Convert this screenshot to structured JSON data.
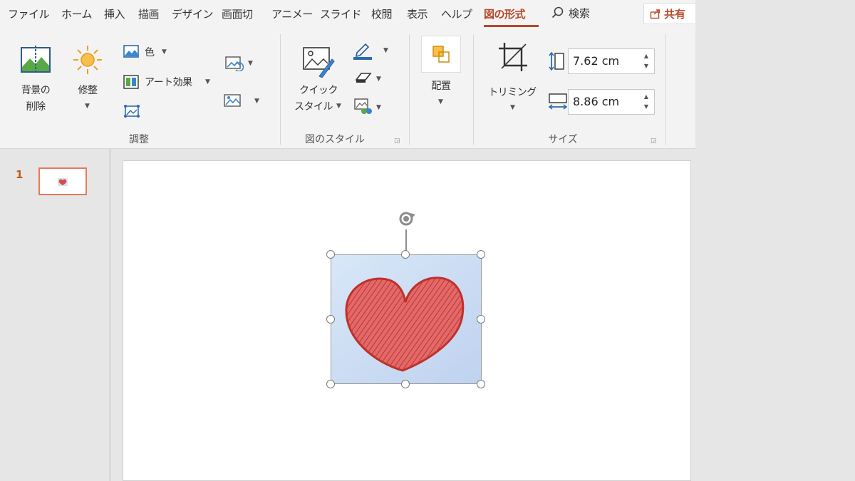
{
  "tabs": [
    "ファイル",
    "ホーム",
    "挿入",
    "描画",
    "デザイン",
    "画面切",
    "アニメー",
    "スライド",
    "校閲",
    "表示",
    "ヘルプ",
    "図の形式"
  ],
  "active_tab": "図の形式",
  "search_label": "検索",
  "share_label": "共有",
  "ribbon": {
    "remove_bg_line1": "背景の",
    "remove_bg_line2": "削除",
    "corrections": "修整",
    "color": "色",
    "artistic_effects": "アート効果",
    "group_adjust": "調整",
    "quick_styles_line1": "クイック",
    "quick_styles_line2": "スタイル",
    "group_picture_styles": "図のスタイル",
    "arrange": "配置",
    "crop": "トリミング",
    "height_value": "7.62 cm",
    "width_value": "8.86 cm",
    "group_size": "サイズ"
  },
  "slides": {
    "number": "1"
  },
  "colors": {
    "accent": "#b7472a",
    "picture_bg": "#cfe0f5",
    "heart": "#d94a4a"
  }
}
